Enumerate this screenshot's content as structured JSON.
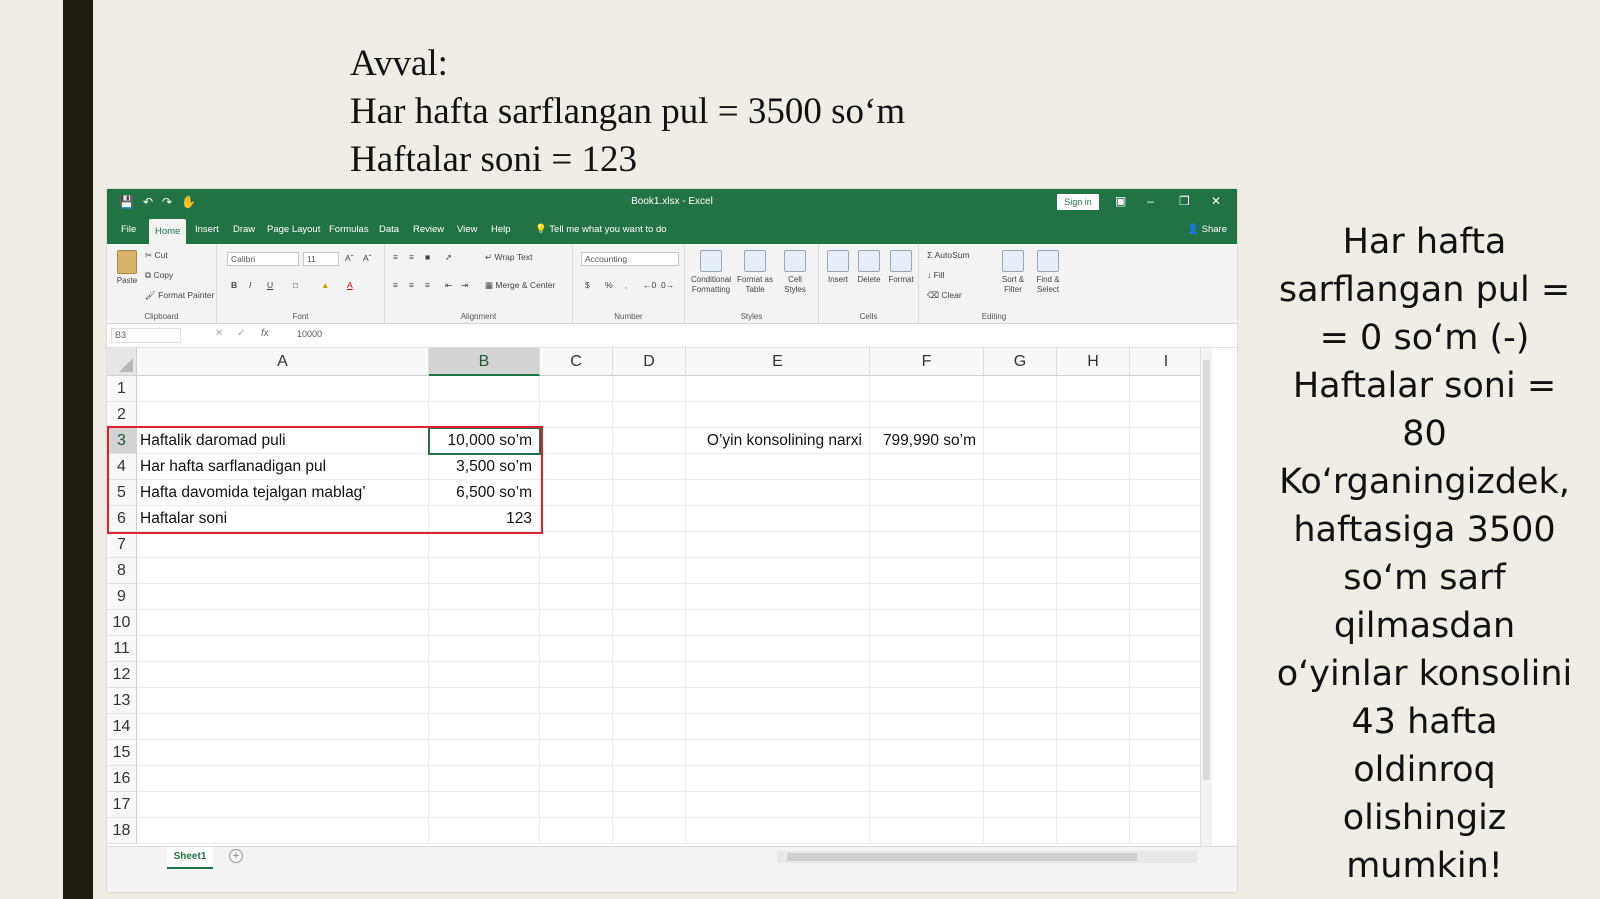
{
  "slide": {
    "heading_lines": [
      "Avval:",
      "Har hafta sarflangan pul = 3500 so‘m",
      "Haftalar soni = 123"
    ],
    "note_lines": [
      "Har hafta",
      "sarflangan pul =",
      "= 0 so‘m (-)",
      "Haftalar soni =",
      "80",
      "Ko‘rganingizdek,",
      "haftasiga 3500",
      "so‘m sarf",
      "qilmasdan",
      "o‘yinlar konsolini",
      "43 hafta",
      "oldinroq",
      "olishingiz",
      "mumkin!"
    ]
  },
  "excel": {
    "title": "Book1.xlsx  -  Excel",
    "sign_in": "Sign in",
    "tabs": [
      "File",
      "Home",
      "Insert",
      "Draw",
      "Page Layout",
      "Formulas",
      "Data",
      "Review",
      "View",
      "Help"
    ],
    "tell_me": "Tell me what you want to do",
    "share": "Share",
    "ribbon": {
      "clipboard": {
        "label": "Clipboard",
        "paste": "Paste",
        "cut": "Cut",
        "copy": "Copy",
        "format_painter": "Format Painter"
      },
      "font": {
        "label": "Font",
        "name": "Calibri",
        "size": "11",
        "bold": "B",
        "italic": "I",
        "underline": "U",
        "font_color": "A"
      },
      "alignment": {
        "label": "Alignment",
        "wrap": "Wrap Text",
        "merge": "Merge & Center"
      },
      "number": {
        "label": "Number",
        "format": "Accounting",
        "currency": "$",
        "percent": "%"
      },
      "styles": {
        "label": "Styles",
        "conditional": "Conditional Formatting",
        "format_table": "Format as Table",
        "cell_styles": "Cell Styles"
      },
      "cells": {
        "label": "Cells",
        "insert": "Insert",
        "delete": "Delete",
        "format": "Format"
      },
      "editing": {
        "label": "Editing",
        "autosum": "AutoSum",
        "fill": "Fill",
        "clear": "Clear",
        "sort": "Sort & Filter",
        "find": "Find & Select"
      }
    },
    "name_box": "B3",
    "formula": "10000",
    "columns": [
      "A",
      "B",
      "C",
      "D",
      "E",
      "F",
      "G",
      "H",
      "I"
    ],
    "rows": [
      "1",
      "2",
      "3",
      "4",
      "5",
      "6",
      "7",
      "8",
      "9",
      "10",
      "11",
      "12",
      "13",
      "14",
      "15",
      "16",
      "17",
      "18"
    ],
    "data_rows": [
      {
        "label": "Haftalik daromad puli",
        "value": "10,000 so’m"
      },
      {
        "label": "Har hafta sarflanadigan pul",
        "value": "3,500 so’m"
      },
      {
        "label": "Hafta davomida tejalgan mablag’",
        "value": "6,500 so’m"
      },
      {
        "label": "Haftalar soni",
        "value": "123"
      }
    ],
    "console_label": "O’yin konsolining narxi",
    "console_price": "799,990 so’m",
    "sheet_tab": "Sheet1"
  }
}
